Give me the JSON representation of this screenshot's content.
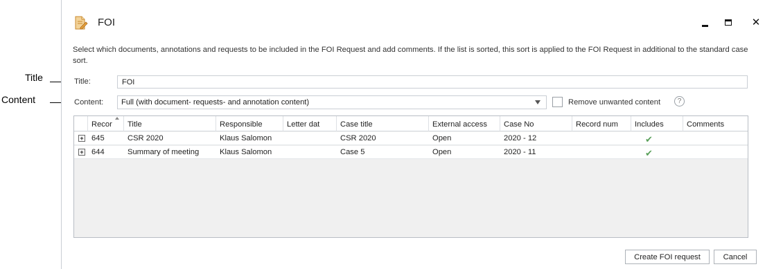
{
  "callouts": {
    "title": "Title",
    "content": "Content"
  },
  "window": {
    "title": "FOI",
    "minimize": "minimize",
    "maximize": "maximize",
    "close_glyph": "✕"
  },
  "instructions": "Select which documents, annotations and requests to be included in the FOI Request and add comments. If the list is sorted, this sort is applied to the FOI Request in additional to the standard case sort.",
  "form": {
    "title_label": "Title:",
    "title_value": "FOI",
    "content_label": "Content:",
    "content_value": "Full (with document- requests- and annotation content)",
    "remove_unwanted_label": "Remove unwanted content",
    "remove_unwanted_checked": false,
    "help_glyph": "?"
  },
  "grid": {
    "columns": [
      "Recor",
      "Title",
      "Responsible",
      "Letter dat",
      "Case title",
      "External access",
      "Case No",
      "Record num",
      "Includes",
      "Comments"
    ],
    "sort_column": "Recor",
    "rows": [
      {
        "expander": "+",
        "record": "645",
        "title": "CSR 2020",
        "responsible": "Klaus Salomon",
        "letter_date": "",
        "case_title": "CSR 2020",
        "external_access": "Open",
        "case_no": "2020 - 12",
        "record_num": "",
        "includes": true,
        "comments": ""
      },
      {
        "expander": "+",
        "record": "644",
        "title": "Summary of meeting",
        "responsible": "Klaus Salomon",
        "letter_date": "",
        "case_title": "Case 5",
        "external_access": "Open",
        "case_no": "2020 - 11",
        "record_num": "",
        "includes": true,
        "comments": ""
      }
    ],
    "includes_icon": "checkmark-icon",
    "includes_glyph": "✔"
  },
  "buttons": {
    "create": "Create FOI request",
    "cancel": "Cancel"
  },
  "colors": {
    "border": "#c9ced4",
    "check": "#5aa05a",
    "grid_bg": "#f0f0f0"
  }
}
